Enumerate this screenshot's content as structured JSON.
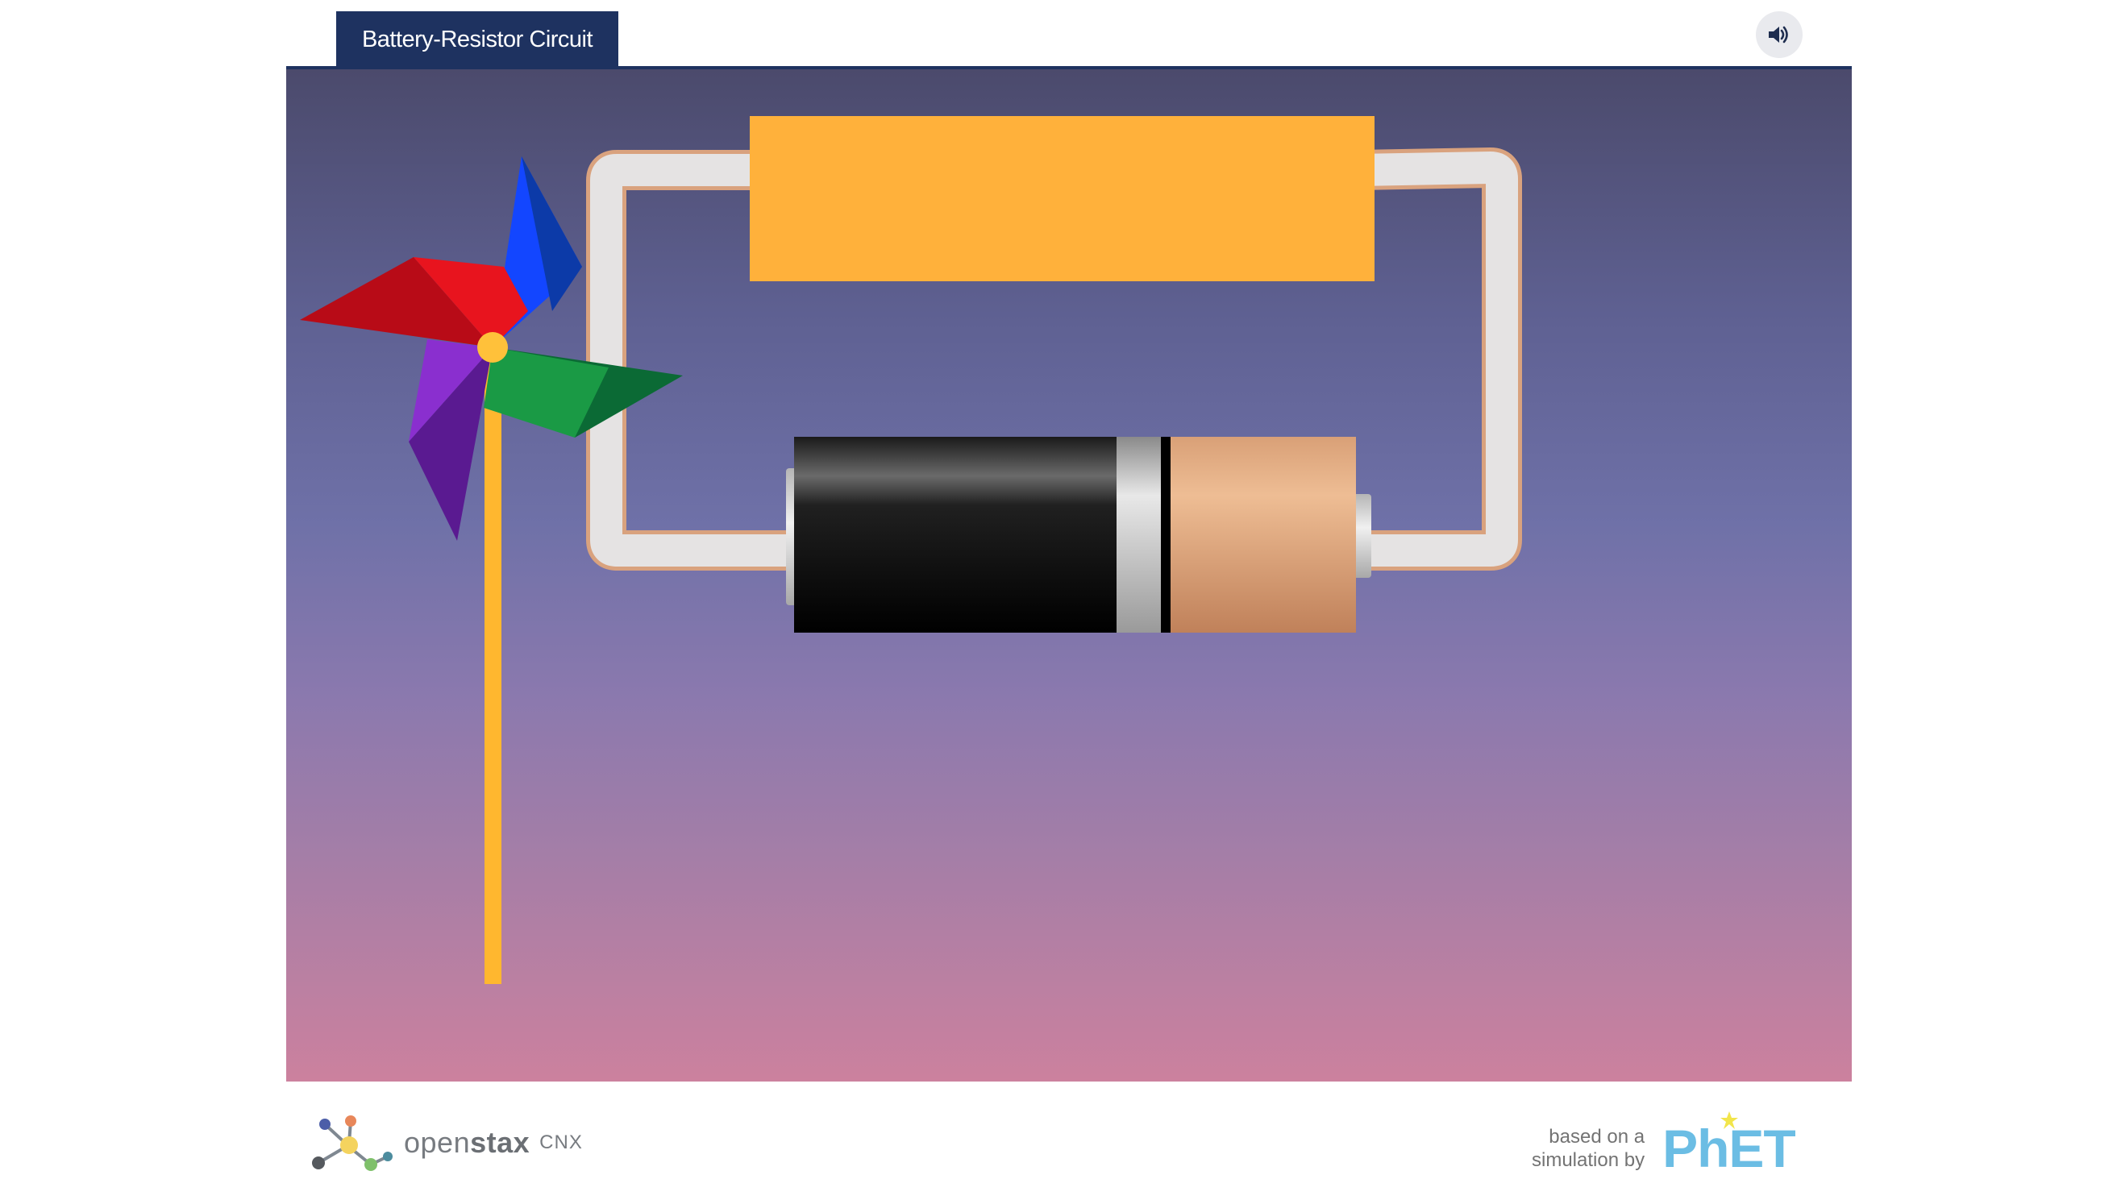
{
  "header": {
    "tab_title": "Battery-Resistor Circuit",
    "sound_icon": "speaker-icon"
  },
  "stage": {
    "gradient_top": "#4b4a6c",
    "gradient_bottom": "#cc819e",
    "resistor_color": "#ffb13b",
    "wire_color": "#e5e3e3",
    "wire_outline_color": "#d9a27e",
    "pinwheel_center_color": "#ffc13a",
    "pinwheel_stick_color": "#ffb72f",
    "pinwheel_blade_colors": [
      "#0c3aa8",
      "#e8141e",
      "#8a2fcf",
      "#1a9a45"
    ]
  },
  "footer": {
    "openstax_prefix": "open",
    "openstax_bold": "stax",
    "cnx_label": "CNX",
    "based_on_line1": "based on a",
    "based_on_line2": "simulation by",
    "phet_logo_text": "PhET"
  }
}
